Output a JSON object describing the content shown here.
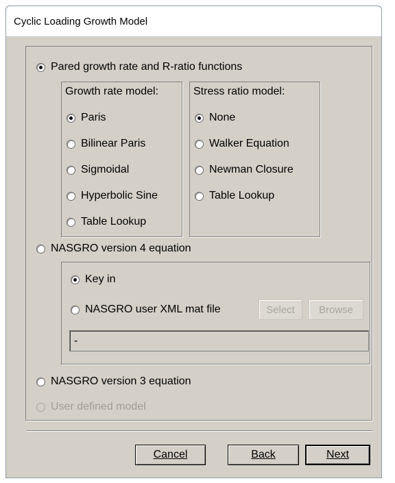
{
  "window": {
    "title": "Cyclic Loading Growth Model"
  },
  "model": {
    "pared_label": "Pared growth rate and R-ratio functions",
    "growth_rate": {
      "title": "Growth rate model:",
      "options": [
        "Paris",
        "Bilinear Paris",
        "Sigmoidal",
        "Hyperbolic Sine",
        "Table Lookup"
      ],
      "selected": "Paris"
    },
    "stress_ratio": {
      "title": "Stress ratio model:",
      "options": [
        "None",
        "Walker Equation",
        "Newman Closure",
        "Table Lookup"
      ],
      "selected": "None"
    },
    "nasgro4_label": "NASGRO version 4 equation",
    "nasgro4": {
      "key_in_label": "Key in",
      "xml_label": "NASGRO user XML mat file",
      "select_label": "Select",
      "browse_label": "Browse",
      "file_value": "-"
    },
    "nasgro3_label": "NASGRO version 3 equation",
    "user_defined_label": "User defined model",
    "selected": "pared"
  },
  "footer": {
    "cancel_label": "Cancel",
    "back_label": "Back",
    "next_label": "Next"
  }
}
